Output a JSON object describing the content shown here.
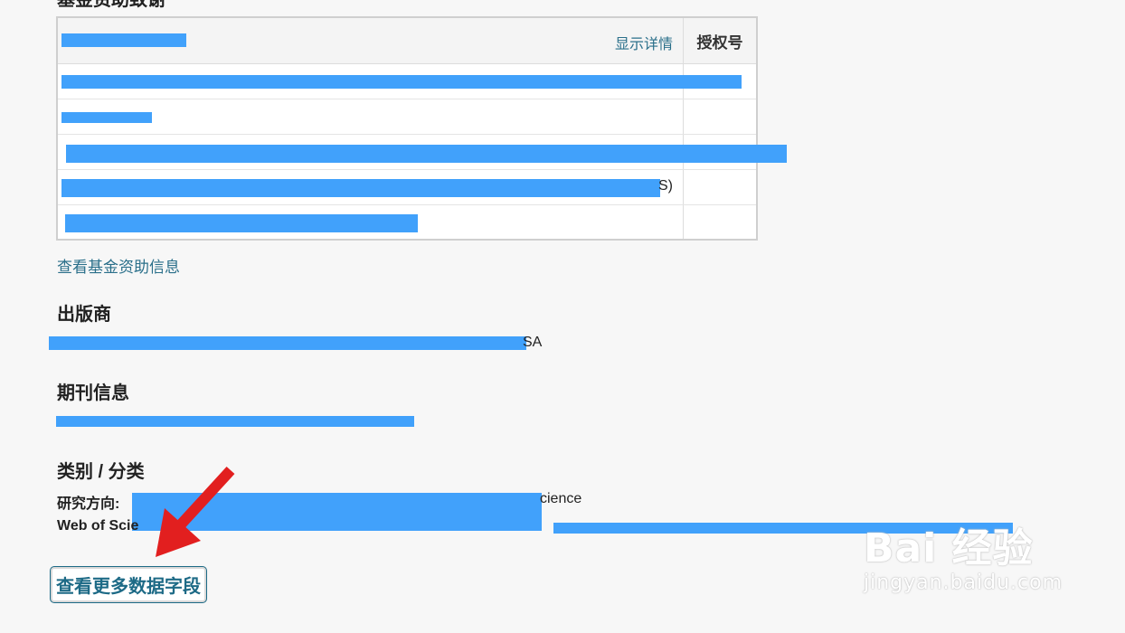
{
  "funding": {
    "title": "基金资助致谢",
    "show_details": "显示详情",
    "grant_header": "授权号",
    "row_fragments": [
      "",
      "",
      "",
      "S)",
      ""
    ],
    "view_funding_link": "查看基金资助信息"
  },
  "publisher": {
    "title": "出版商",
    "tail": "SA"
  },
  "journal": {
    "title": "期刊信息"
  },
  "category": {
    "title": "类别 / 分类",
    "research_label": "研究方向:",
    "research_tail": "cience",
    "wos_label": "Web of Scie"
  },
  "more_fields_button": "查看更多数据字段",
  "watermark": {
    "brand": "Bai 经验",
    "url": "jingyan.baidu.com"
  },
  "colors": {
    "redaction": "#41a1fb",
    "link": "#2a6f8a",
    "arrow": "#e21f1f"
  }
}
